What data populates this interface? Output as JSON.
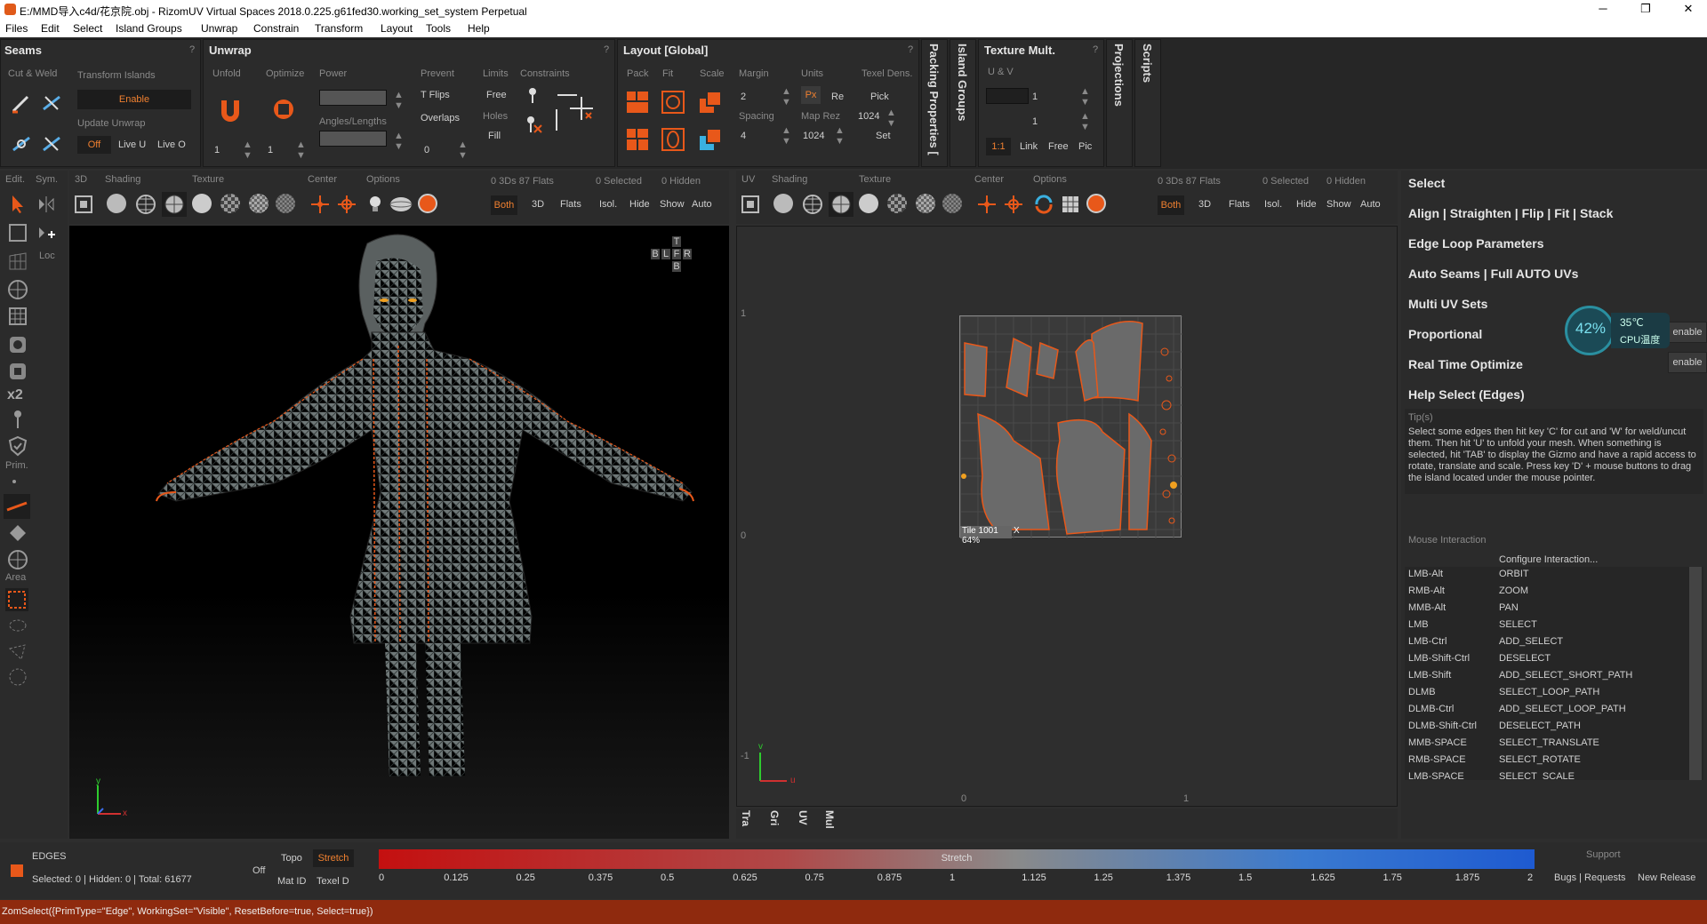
{
  "window": {
    "title": "E:/MMD导入c4d/花京院.obj - RizomUV  Virtual Spaces 2018.0.225.g61fed30.working_set_system Perpetual",
    "min": "─",
    "max": "❐",
    "close": "✕"
  },
  "menu": [
    "Files",
    "Edit",
    "Select",
    "Island Groups",
    "Unwrap",
    "Constrain",
    "Transform",
    "Layout",
    "Tools",
    "Help"
  ],
  "seams": {
    "title": "Seams",
    "help": "?",
    "cut_weld": "Cut & Weld",
    "transform_islands": "Transform Islands",
    "enable": "Enable",
    "update_unwrap": "Update Unwrap",
    "off": "Off",
    "live_u": "Live U",
    "live_o": "Live O"
  },
  "unwrap": {
    "title": "Unwrap",
    "help": "?",
    "unfold": "Unfold",
    "optimize": "Optimize",
    "power": "Power",
    "prevent": "Prevent",
    "limits": "Limits",
    "constraints": "Constraints",
    "tflips": "T Flips",
    "free": "Free",
    "angles_lengths": "Angles/Lengths",
    "overlaps": "Overlaps",
    "holes": "Holes",
    "fill": "Fill",
    "v1": "1",
    "v2": "1",
    "v3": "0"
  },
  "layout": {
    "title": "Layout [Global]",
    "help": "?",
    "pack": "Pack",
    "fit": "Fit",
    "scale": "Scale",
    "margin": "Margin",
    "margin_val": "2",
    "units": "Units",
    "px": "Px",
    "re": "Re",
    "texel_dens": "Texel Dens.",
    "pick": "Pick",
    "spacing": "Spacing",
    "spacing_val": "4",
    "map_rez": "Map Rez",
    "map_rez_a": "1024",
    "map_rez_b": "1024",
    "set": "Set"
  },
  "vtabs": {
    "packing": "Packing Properties [",
    "island_groups": "Island Groups",
    "projections": "Projections",
    "scripts": "Scripts"
  },
  "texture_mult": {
    "title": "Texture Mult.",
    "help": "?",
    "uv": "U & V",
    "v1": "1",
    "v2": "1",
    "ratio": "1:1",
    "link": "Link",
    "free": "Free",
    "pic": "Pic"
  },
  "left_tools": {
    "edit": "Edit.",
    "sym": "Sym.",
    "loc": "Loc",
    "x2": "x2",
    "prim": "Prim.",
    "area": "Area"
  },
  "view3d": {
    "label3d": "3D",
    "shading": "Shading",
    "texture": "Texture",
    "center": "Center",
    "options": "Options",
    "stats": "0 3Ds 87 Flats",
    "selected": "0 Selected",
    "hidden": "0 Hidden",
    "both": "Both",
    "b3d": "3D",
    "flats": "Flats",
    "isol": "Isol.",
    "hide": "Hide",
    "show": "Show",
    "auto": "Auto",
    "axis_y": "y",
    "axis_x": "x",
    "cube": [
      "T",
      "B",
      "L",
      "F",
      "R",
      "B"
    ]
  },
  "viewuv": {
    "label": "UV",
    "shading": "Shading",
    "texture": "Texture",
    "center": "Center",
    "options": "Options",
    "stats": "0 3Ds 87 Flats",
    "selected": "0 Selected",
    "hidden": "0 Hidden",
    "both": "Both",
    "b3d": "3D",
    "flats": "Flats",
    "isol": "Isol.",
    "hide": "Hide",
    "show": "Show",
    "auto": "Auto",
    "tile": "Tile 1001 64%",
    "tile_x": "X",
    "axis_v": "v",
    "axis_u": "u",
    "r1": "1",
    "r0": "0",
    "rm1": "-1",
    "b0": "0",
    "b1": "1",
    "tabs": [
      "Tra",
      "Gri",
      "UV",
      "Mul"
    ]
  },
  "right": {
    "select": "Select",
    "align": "Align | Straighten | Flip | Fit | Stack",
    "edge_loop": "Edge Loop Parameters",
    "auto_seams": "Auto Seams | Full AUTO UVs",
    "multi_uv": "Multi UV Sets",
    "proportional": "Proportional",
    "realtime": "Real Time Optimize",
    "help_select": "Help Select (Edges)",
    "enable1": "enable",
    "enable2": "enable",
    "tips_label": "Tip(s)",
    "tips": "Select some edges then hit key 'C' for cut and 'W' for weld/uncut them. Then hit 'U' to unfold your mesh. When something is selected, hit 'TAB' to display the Gizmo and have a rapid access to rotate, translate and scale. Press key 'D' + mouse buttons to drag the island located under the mouse pointer.",
    "mouse_interaction": "Mouse Interaction",
    "configure": "Configure Interaction...",
    "cpu_pct": "42%",
    "cpu_temp": "35℃",
    "cpu_label": "CPU温度",
    "bindings": [
      [
        "LMB-Alt",
        "ORBIT"
      ],
      [
        "RMB-Alt",
        "ZOOM"
      ],
      [
        "MMB-Alt",
        "PAN"
      ],
      [
        "LMB",
        "SELECT"
      ],
      [
        "LMB-Ctrl",
        "ADD_SELECT"
      ],
      [
        "LMB-Shift-Ctrl",
        "DESELECT"
      ],
      [
        "LMB-Shift",
        "ADD_SELECT_SHORT_PATH"
      ],
      [
        "DLMB",
        "SELECT_LOOP_PATH"
      ],
      [
        "DLMB-Ctrl",
        "ADD_SELECT_LOOP_PATH"
      ],
      [
        "DLMB-Shift-Ctrl",
        "DESELECT_PATH"
      ],
      [
        "MMB-SPACE",
        "SELECT_TRANSLATE"
      ],
      [
        "RMB-SPACE",
        "SELECT_ROTATE"
      ],
      [
        "LMB-SPACE",
        "SELECT_SCALE"
      ]
    ]
  },
  "bottom": {
    "mode": "EDGES",
    "counts": "Selected: 0 | Hidden: 0 | Total: 61677",
    "off": "Off",
    "topo": "Topo",
    "stretch": "Stretch",
    "mat_id": "Mat ID",
    "texel_d": "Texel D",
    "bar_label": "Stretch",
    "ticks": [
      "0",
      "0.125",
      "0.25",
      "0.375",
      "0.5",
      "0.625",
      "0.75",
      "0.875",
      "1",
      "1.125",
      "1.25",
      "1.375",
      "1.5",
      "1.625",
      "1.75",
      "1.875",
      "2"
    ],
    "support": "Support",
    "bugs": "Bugs | Requests",
    "new_release": "New Release"
  },
  "status": "ZomSelect({PrimType=\"Edge\", WorkingSet=\"Visible\", ResetBefore=true, Select=true})",
  "colors": {
    "accent": "#e8581a",
    "panel": "#2b2b2b",
    "viewport": "#000000",
    "status": "#8f2a0e"
  }
}
